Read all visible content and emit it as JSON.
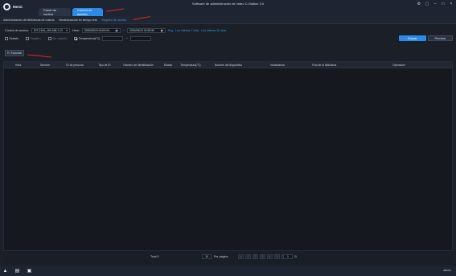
{
  "menu": {
    "label": "Menú"
  },
  "app_title": "Software de administración de vídeo C-Station 3.0",
  "tabs": [
    {
      "label": "Panel de control"
    },
    {
      "label": "Control de acceso"
    }
  ],
  "subtabs": [
    {
      "label": "Administración de bibliotecas de rostros"
    },
    {
      "label": "Monitorización en tiempo real"
    },
    {
      "label": "Registro de acceso"
    }
  ],
  "filters": {
    "access_label": "Control de acceso:",
    "access_value": "IOT-2154_192.168.1.13",
    "time_label": "Hora:",
    "date_from": "2020/08/23 00:00:00",
    "date_to": "2020/08/23 23:59:59",
    "hoy": "Hoy",
    "last7": "Los últimos 7 días",
    "last30": "Los últimos 30 días",
    "state_label": "Estado",
    "opt1": "Registro",
    "opt2": "Sin registro",
    "temp_label": "Temperatura(°C)",
    "dash": "~",
    "search_btn": "Buscar",
    "reset_btn": "Reiniciar"
  },
  "export": {
    "label": "Exportar"
  },
  "table": {
    "columns": [
      "Hora",
      "Nombre",
      "ID de persona",
      "Tipo de ID",
      "Número de identificación",
      "Estado",
      "Temperatura(°C)",
      "Nombre del dispositivo",
      "Instantánea",
      "Foto de la biblioteca",
      "Operación"
    ]
  },
  "footer": {
    "total": "Total 0",
    "page_size": "10",
    "per_page": "Por página",
    "pages": [
      "<",
      "1",
      "2",
      "3",
      "4",
      "5",
      ">"
    ],
    "goto_value": "1",
    "goto_suffix": "/1"
  },
  "statusbar": {
    "user": "admin"
  },
  "colors": {
    "accent": "#2a8ce8",
    "background": "#1b1f28",
    "annotation": "#e0242e"
  }
}
